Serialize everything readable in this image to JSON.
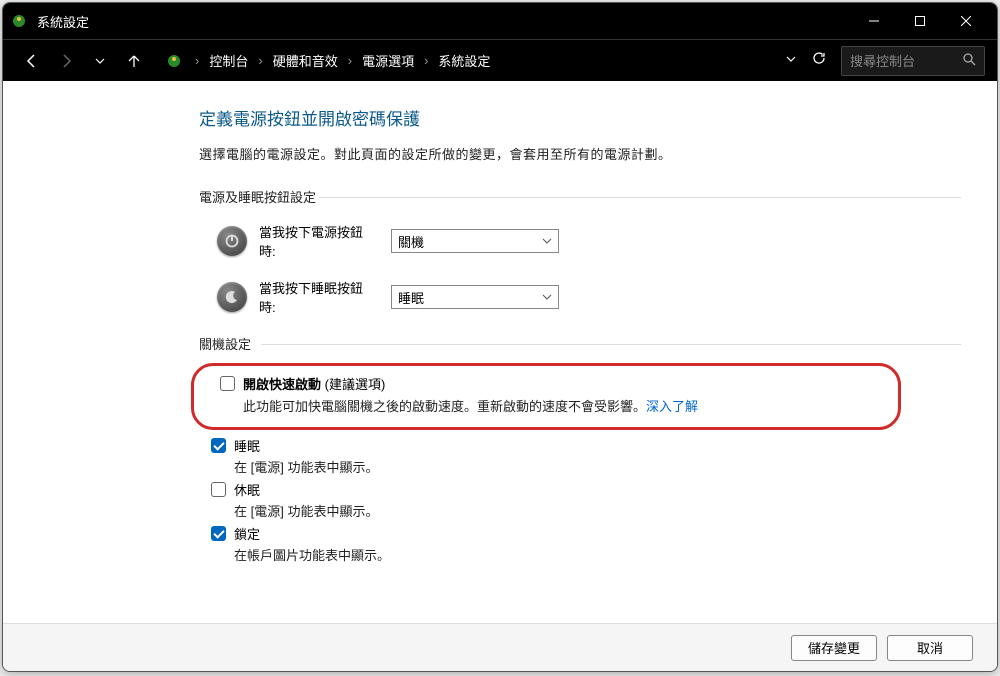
{
  "window": {
    "title": "系統設定"
  },
  "search": {
    "placeholder": "搜尋控制台"
  },
  "breadcrumb": {
    "items": [
      "控制台",
      "硬體和音效",
      "電源選項",
      "系統設定"
    ]
  },
  "page": {
    "title": "定義電源按鈕並開啟密碼保護",
    "desc": "選擇電腦的電源設定。對此頁面的設定所做的變更，會套用至所有的電源計劃。"
  },
  "sections": {
    "button_section": "電源及睡眠按鈕設定",
    "shutdown_section": "關機設定"
  },
  "power_button": {
    "label": "當我按下電源按鈕時:",
    "value": "關機"
  },
  "sleep_button": {
    "label": "當我按下睡眠按鈕時:",
    "value": "睡眠"
  },
  "fast_startup": {
    "label": "開啟快速啟動",
    "rec": "(建議選項)",
    "desc": "此功能可加快電腦關機之後的啟動速度。重新啟動的速度不會受影響。",
    "link": "深入了解",
    "checked": false
  },
  "sleep": {
    "label": "睡眠",
    "desc": "在 [電源] 功能表中顯示。",
    "checked": true
  },
  "hibernate": {
    "label": "休眠",
    "desc": "在 [電源] 功能表中顯示。",
    "checked": false
  },
  "lock": {
    "label": "鎖定",
    "desc": "在帳戶圖片功能表中顯示。",
    "checked": true
  },
  "footer": {
    "save": "儲存變更",
    "cancel": "取消"
  }
}
